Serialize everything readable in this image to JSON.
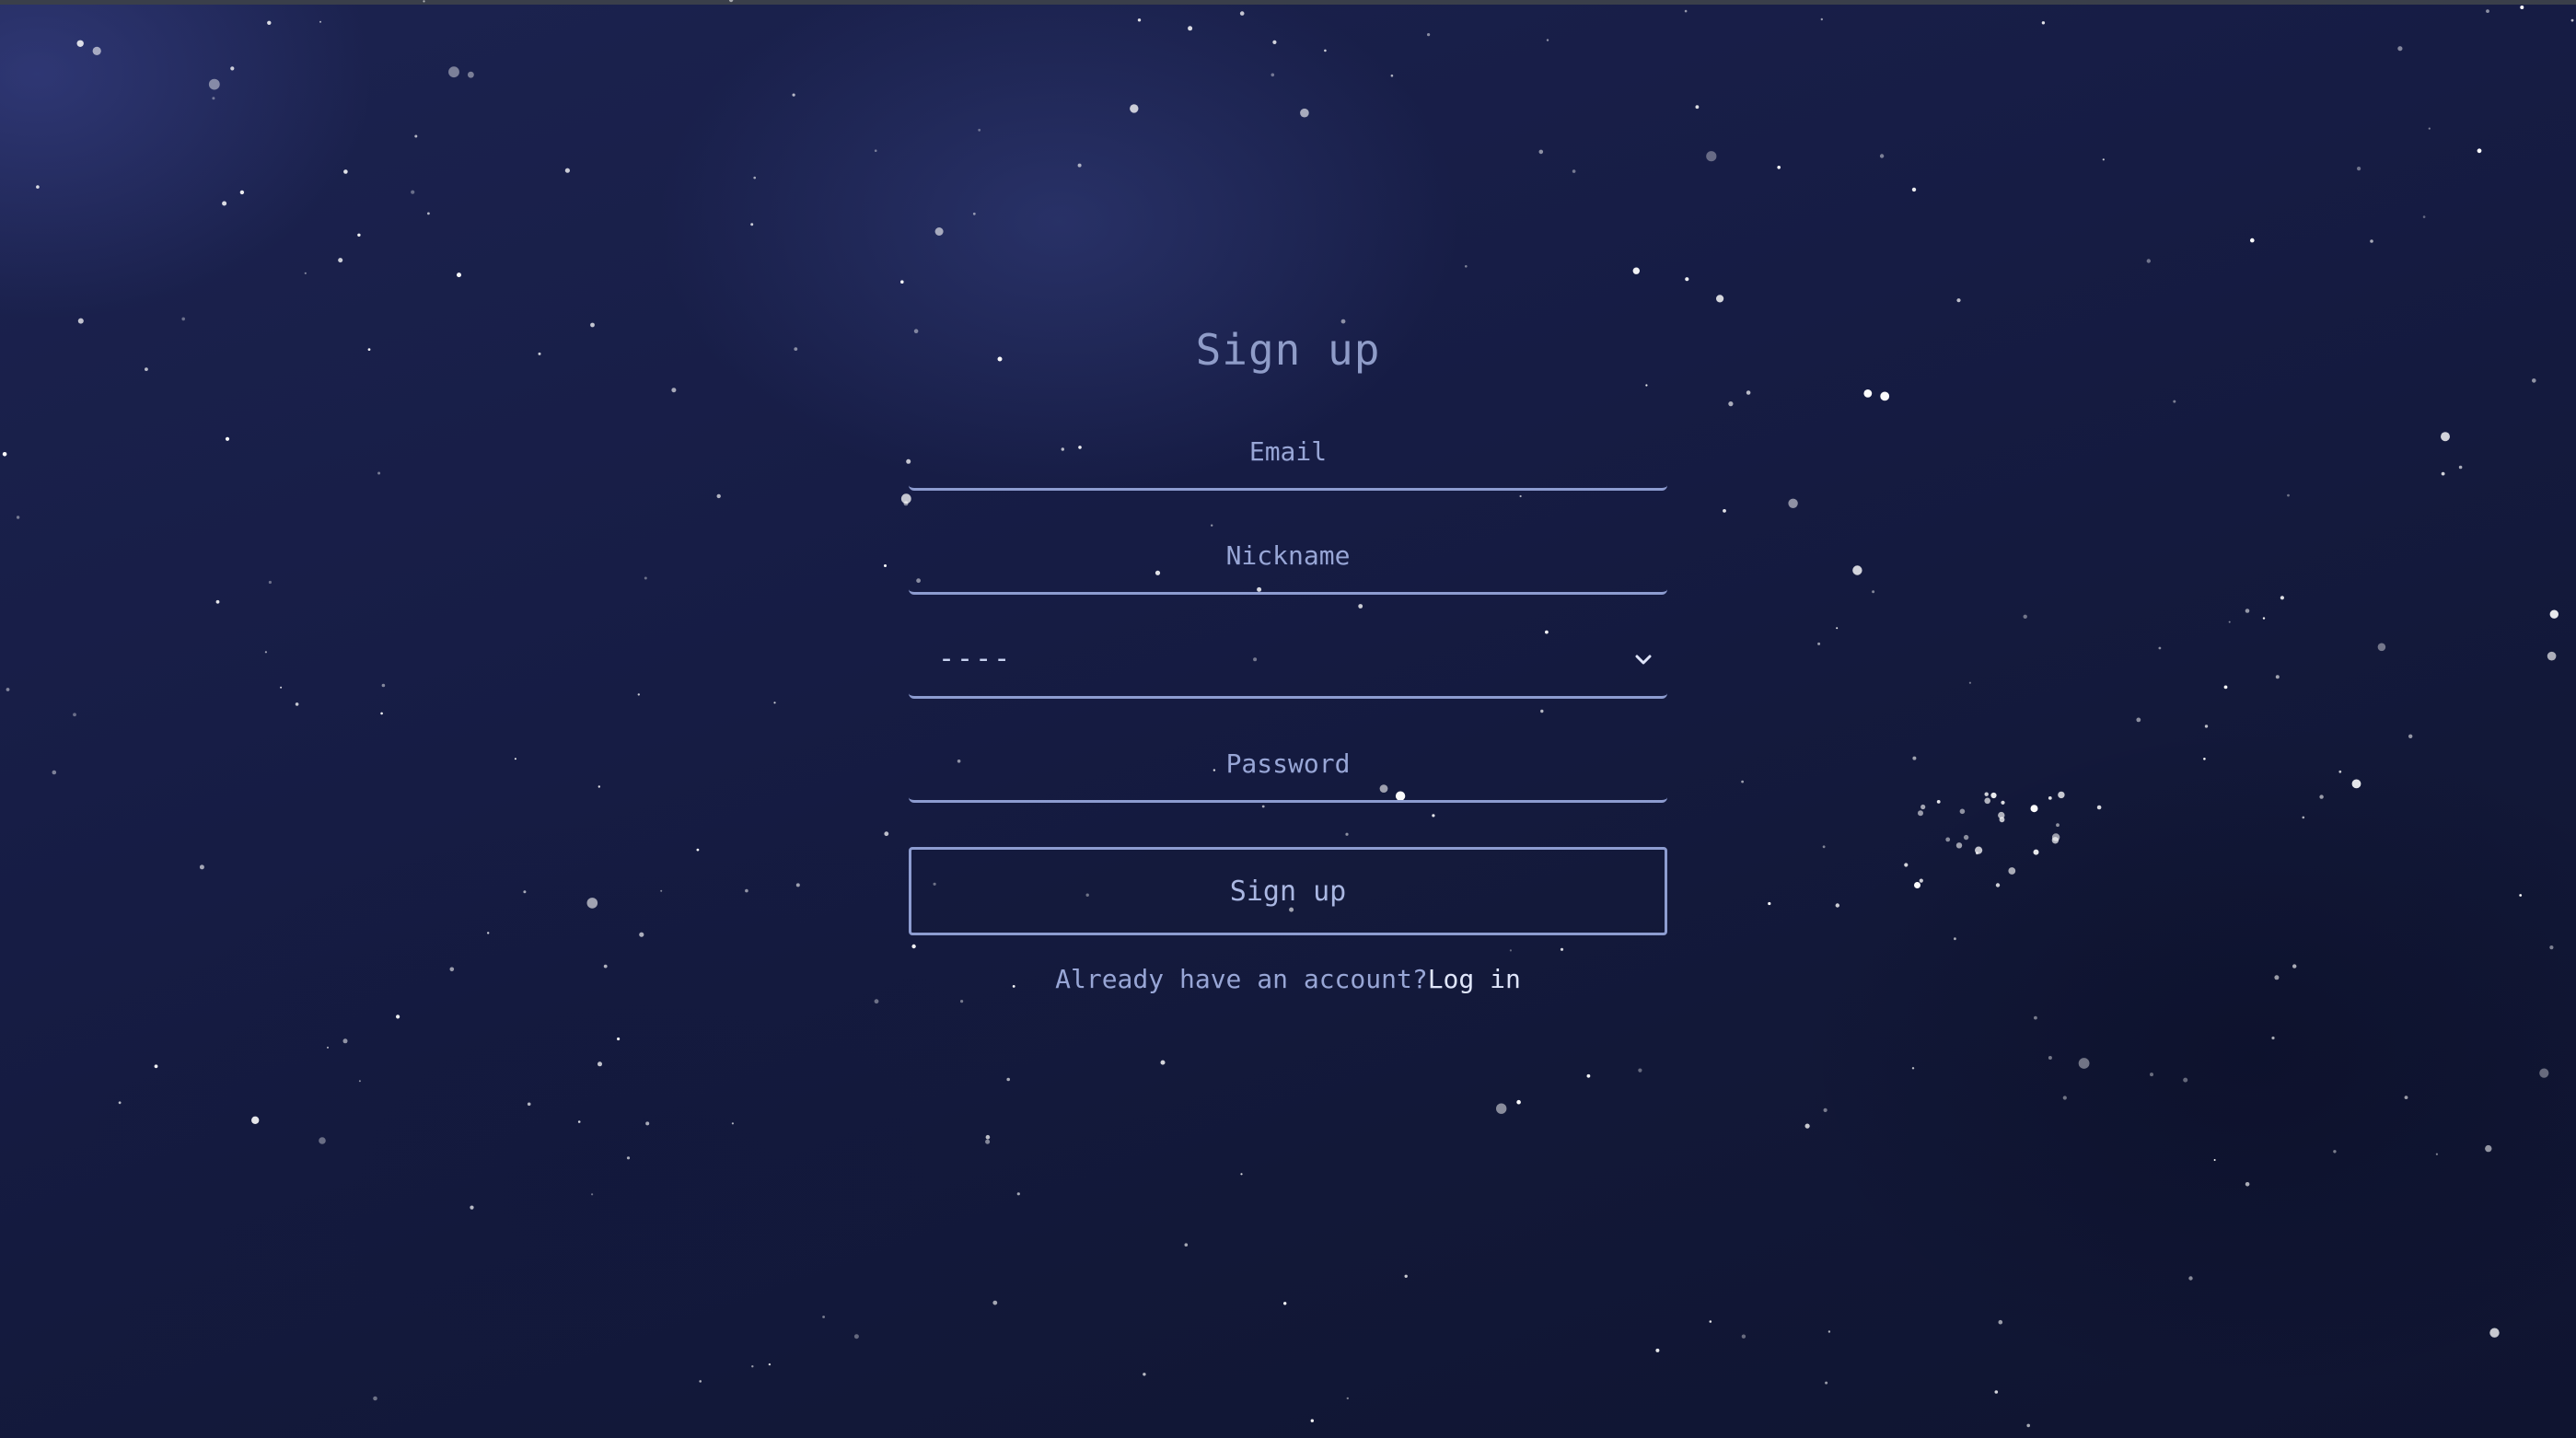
{
  "page": {
    "title": "Sign up"
  },
  "form": {
    "email": {
      "placeholder": "Email",
      "value": ""
    },
    "nickname": {
      "placeholder": "Nickname",
      "value": ""
    },
    "role_select": {
      "selected": "----",
      "icon": "chevron-down-icon"
    },
    "password": {
      "placeholder": "Password",
      "value": ""
    },
    "submit_label": "Sign up"
  },
  "footer": {
    "prompt": "Already have an account?",
    "login_label": "Log in"
  },
  "colors": {
    "background": "#141a38",
    "accent": "#8d9cd0",
    "text": "#98a6d6"
  }
}
